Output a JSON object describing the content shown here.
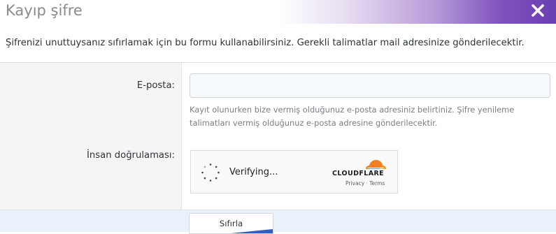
{
  "dialog": {
    "title": "Kayıp şifre",
    "close_icon": "close-icon"
  },
  "intro_text": "Şifrenizi unuttuysanız sıfırlamak için bu formu kullanabilirsiniz. Gerekli talimatlar mail adresinize gönderilecektir.",
  "form": {
    "email_label": "E-posta:",
    "email_value": "",
    "email_hint": "Kayıt olunurken bize vermiş olduğunuz e-posta adresiniz belirtiniz. Şifre yenileme talimatları vermiş olduğunuz e-posta adresine gönderilecektir.",
    "human_label": "İnsan doğrulaması:"
  },
  "captcha": {
    "status": "Verifying...",
    "brand": "CLOUDFLARE",
    "privacy": "Privacy",
    "separator": "·",
    "terms": "Terms",
    "brand_color": "#f38020"
  },
  "submit_label": "Sıfırla",
  "colors": {
    "header_gradient_end": "#6a3fb2",
    "footer_bg": "#e9f1fb",
    "button_accent": "#2f5fc4"
  }
}
